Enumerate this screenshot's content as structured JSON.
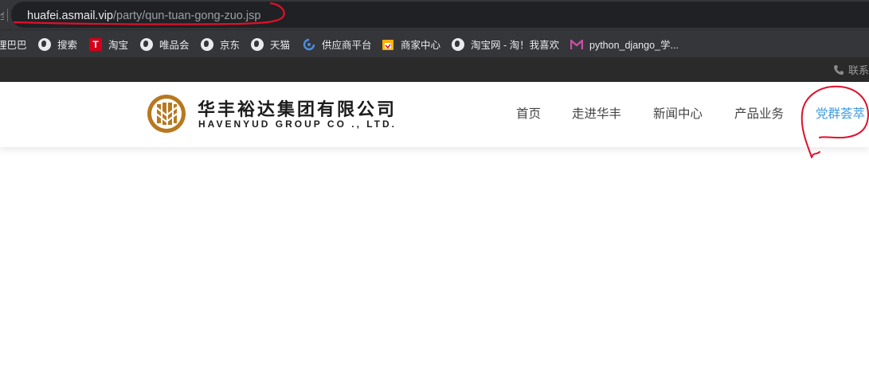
{
  "browser": {
    "url_host": "huafei.asmail.vip",
    "url_path": "/party/qun-tuan-gong-zuo.jsp",
    "left_glyph": "全"
  },
  "bookmarks": [
    {
      "label": "理巴巴",
      "icon": ""
    },
    {
      "label": "搜索",
      "icon": "globe-icon"
    },
    {
      "label": "淘宝",
      "icon": "tmall-icon",
      "icon_text": "T"
    },
    {
      "label": "唯品会",
      "icon": "globe-icon"
    },
    {
      "label": "京东",
      "icon": "globe-icon"
    },
    {
      "label": "天猫",
      "icon": "globe-icon"
    },
    {
      "label": "供应商平台",
      "icon": "swirl-icon"
    },
    {
      "label": "商家中心",
      "icon": "shop-icon"
    },
    {
      "label": "淘宝网 - 淘！我喜欢",
      "icon": "globe-icon"
    },
    {
      "label": "python_django_学...",
      "icon": "m-logo-icon"
    }
  ],
  "topstrip": {
    "contact": "联系"
  },
  "site": {
    "logo_cn": "华丰裕达集团有限公司",
    "logo_en": "HAVENYUD GROUP CO ., LTD.",
    "nav": [
      "首页",
      "走进华丰",
      "新闻中心",
      "产品业务",
      "党群荟萃"
    ],
    "active_nav_color": "#3e9be0"
  },
  "colors": {
    "annotation": "#e0102a",
    "logo_gold": "#b8781f"
  }
}
